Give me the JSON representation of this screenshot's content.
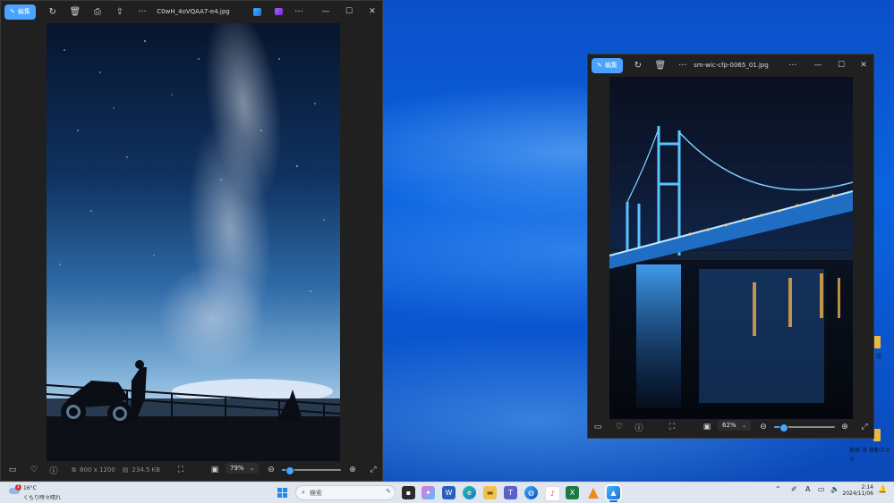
{
  "window1": {
    "edit_label": "編集",
    "title": "C0wH_4oVQAA7-e4.jpg",
    "dimensions": "800 x 1200",
    "filesize": "234.5 KB",
    "zoom": "79%",
    "zoom_fraction": 0.12
  },
  "window2": {
    "edit_label": "編集",
    "title": "sm-wic-cfp-0065_01.jpg",
    "zoom": "62%",
    "zoom_fraction": 0.15
  },
  "desktop": {
    "label_1": "成",
    "label_2": "推奨 済 移動させよ"
  },
  "taskbar": {
    "weather_temp": "16°C",
    "weather_desc": "くもり時々晴れ",
    "weather_badge": "1",
    "search_placeholder": "検索",
    "time": "2:14",
    "date": "2024/11/06"
  }
}
